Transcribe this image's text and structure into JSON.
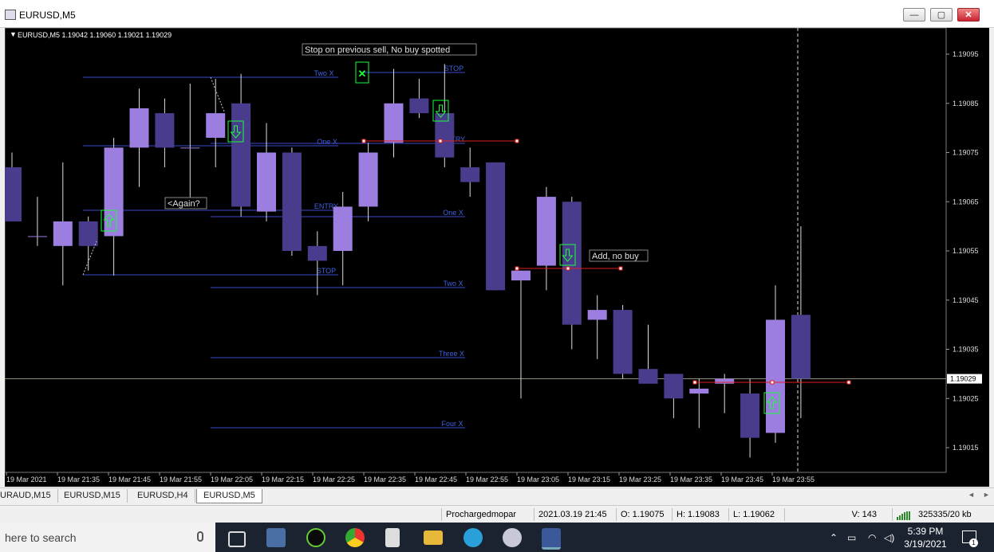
{
  "window": {
    "title": "EURUSD,M5",
    "minimize_label": "—",
    "maximize_label": "▢",
    "close_label": "✕"
  },
  "chart": {
    "header": "EURUSD,M5  1.19042 1.19060 1.19021 1.19029",
    "colors": {
      "bull": "#9b7ee0",
      "bear": "#4a3c8c",
      "level": "#3a4acc",
      "level_text": "#4060e0",
      "red": "#e02020",
      "green": "#1aff3a",
      "current": "#8a8f7a"
    },
    "price_labels": [
      "1.19095",
      "1.19085",
      "1.19075",
      "1.19065",
      "1.19055",
      "1.19045",
      "1.19035",
      "1.19025",
      "1.19015"
    ],
    "current_price": "1.19029",
    "time_labels": [
      "19 Mar 2021",
      "19 Mar 21:35",
      "19 Mar 21:45",
      "19 Mar 21:55",
      "19 Mar 22:05",
      "19 Mar 22:15",
      "19 Mar 22:25",
      "19 Mar 22:35",
      "19 Mar 22:45",
      "19 Mar 22:55",
      "19 Mar 23:05",
      "19 Mar 23:15",
      "19 Mar 23:25",
      "19 Mar 23:35",
      "19 Mar 23:45",
      "19 Mar 23:55"
    ],
    "annotations": {
      "stop_sell": "Stop on previous sell, No buy spotted",
      "again": "<Again?",
      "add_no_buy": "Add, no buy"
    },
    "level_labels": {
      "two_x_top": "Two X",
      "stop_top": "STOP",
      "one_x_top": "One X",
      "entry_top": "ENTRY",
      "entry_mid": "ENTRY",
      "one_x_mid": "One X",
      "stop_mid": "STOP",
      "two_x_mid": "Two X",
      "three_x": "Three X",
      "four_x": "Four X"
    }
  },
  "chart_data": {
    "type": "candlestick",
    "title": "EURUSD,M5",
    "ylim": [
      1.1901,
      1.191
    ],
    "candles": [
      {
        "o": 1.19072,
        "h": 1.19075,
        "l": 1.19063,
        "c": 1.19061
      },
      {
        "o": 1.19058,
        "h": 1.19066,
        "l": 1.19056,
        "c": 1.19058
      },
      {
        "o": 1.19056,
        "h": 1.19073,
        "l": 1.19048,
        "c": 1.19061
      },
      {
        "o": 1.19061,
        "h": 1.19062,
        "l": 1.19051,
        "c": 1.19056
      },
      {
        "o": 1.19058,
        "h": 1.19078,
        "l": 1.1905,
        "c": 1.19076
      },
      {
        "o": 1.19076,
        "h": 1.19088,
        "l": 1.19068,
        "c": 1.19084
      },
      {
        "o": 1.19083,
        "h": 1.19086,
        "l": 1.19072,
        "c": 1.19076
      },
      {
        "o": 1.19076,
        "h": 1.19089,
        "l": 1.19065,
        "c": 1.19076
      },
      {
        "o": 1.19078,
        "h": 1.1909,
        "l": 1.19072,
        "c": 1.19083
      },
      {
        "o": 1.19085,
        "h": 1.19091,
        "l": 1.19062,
        "c": 1.19064
      },
      {
        "o": 1.19063,
        "h": 1.19081,
        "l": 1.19061,
        "c": 1.19075
      },
      {
        "o": 1.19075,
        "h": 1.19076,
        "l": 1.19054,
        "c": 1.19055
      },
      {
        "o": 1.19056,
        "h": 1.19059,
        "l": 1.19046,
        "c": 1.19053
      },
      {
        "o": 1.19055,
        "h": 1.19067,
        "l": 1.19048,
        "c": 1.19064
      },
      {
        "o": 1.19064,
        "h": 1.19077,
        "l": 1.19061,
        "c": 1.19075
      },
      {
        "o": 1.19077,
        "h": 1.19092,
        "l": 1.19074,
        "c": 1.19085
      },
      {
        "o": 1.19086,
        "h": 1.1909,
        "l": 1.19082,
        "c": 1.19083
      },
      {
        "o": 1.19083,
        "h": 1.19093,
        "l": 1.19072,
        "c": 1.19074
      },
      {
        "o": 1.19072,
        "h": 1.19076,
        "l": 1.19066,
        "c": 1.19069
      },
      {
        "o": 1.19073,
        "h": 1.19073,
        "l": 1.19047,
        "c": 1.19047
      },
      {
        "o": 1.19049,
        "h": 1.19051,
        "l": 1.19025,
        "c": 1.19051
      },
      {
        "o": 1.19052,
        "h": 1.19068,
        "l": 1.19047,
        "c": 1.19066
      },
      {
        "o": 1.19065,
        "h": 1.19066,
        "l": 1.19035,
        "c": 1.1904
      },
      {
        "o": 1.19041,
        "h": 1.19046,
        "l": 1.19033,
        "c": 1.19043
      },
      {
        "o": 1.19043,
        "h": 1.19044,
        "l": 1.19029,
        "c": 1.1903
      },
      {
        "o": 1.19031,
        "h": 1.1904,
        "l": 1.19029,
        "c": 1.19028
      },
      {
        "o": 1.1903,
        "h": 1.1903,
        "l": 1.19021,
        "c": 1.19025
      },
      {
        "o": 1.19026,
        "h": 1.19029,
        "l": 1.19019,
        "c": 1.19027
      },
      {
        "o": 1.19028,
        "h": 1.1903,
        "l": 1.19022,
        "c": 1.19029
      },
      {
        "o": 1.19026,
        "h": 1.19029,
        "l": 1.19013,
        "c": 1.19017
      },
      {
        "o": 1.19018,
        "h": 1.19048,
        "l": 1.19016,
        "c": 1.19041
      },
      {
        "o": 1.19042,
        "h": 1.1906,
        "l": 1.19021,
        "c": 1.19029
      }
    ]
  },
  "tabs": {
    "items": [
      "URAUD,M15",
      "EURUSD,M15",
      "EURUSD,H4",
      "EURUSD,M5"
    ],
    "active_index": 3,
    "left_arrow": "◄",
    "right_arrow": "►"
  },
  "status": {
    "profile": "Prochargedmopar",
    "datetime": "2021.03.19 21:45",
    "open": "O: 1.19075",
    "high": "H: 1.19083",
    "low": "L: 1.19062",
    "volume": "V: 143",
    "traffic": "325335/20 kb"
  },
  "taskbar": {
    "search_placeholder": "here to search",
    "time": "5:39 PM",
    "date": "3/19/2021",
    "notification_count": "1"
  }
}
